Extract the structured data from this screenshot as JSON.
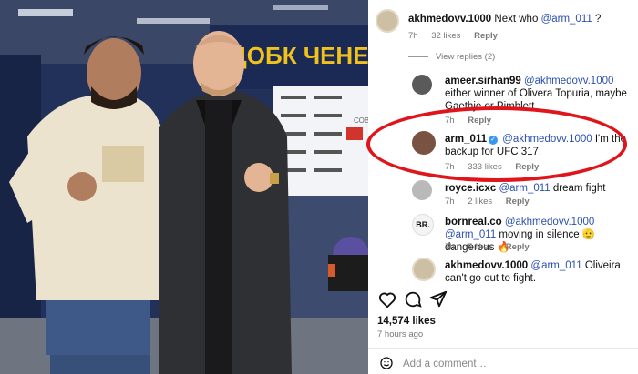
{
  "photo": {
    "banner_text": "ЗДОБК ЧЕНЕД",
    "right_side_text": "СОВ"
  },
  "comments": [
    {
      "username": "akhmedovv.1000",
      "text_pre": "Next who ",
      "mention": "@arm_011",
      "text_post": " ?",
      "age": "7h",
      "likes": "32 likes",
      "reply": "Reply"
    },
    {
      "username": "ameer.sirhan99",
      "mention": "@akhmedovv.1000",
      "text_post": " either winner of Olivera Topuria, maybe Gaethje or Pimblett",
      "age": "7h",
      "reply": "Reply"
    },
    {
      "username": "arm_011",
      "mention": "@akhmedovv.1000",
      "text_post": " I'm the backup for UFC 317.",
      "age": "7h",
      "likes": "333 likes",
      "reply": "Reply"
    },
    {
      "username": "royce.icxc",
      "mention": "@arm_011",
      "text_post": " dream fight",
      "age": "7h",
      "likes": "2 likes",
      "reply": "Reply"
    },
    {
      "username": "bornreal.co",
      "mention": "@akhmedovv.1000",
      "mention2": "@arm_011",
      "text_post": " moving in silence 🫡 dangerous 🔥",
      "avatar_text": "BR.",
      "age": "7h",
      "likes": "5 likes",
      "reply": "Reply"
    },
    {
      "username": "akhmedovv.1000",
      "mention": "@arm_011",
      "text_post": " Oliveira can't go out to fight."
    }
  ],
  "view_replies": "View replies (2)",
  "post": {
    "likes": "14,574 likes",
    "time": "7 hours ago",
    "add_comment_placeholder": "Add a comment…"
  },
  "icons": [
    "heart-icon",
    "comment-icon",
    "share-icon",
    "emoji-icon",
    "verified-badge-icon"
  ],
  "colors": {
    "highlight": "#e0151c",
    "mention": "#2c4fb0",
    "verified": "#3897f0",
    "meta_text": "#777777"
  }
}
